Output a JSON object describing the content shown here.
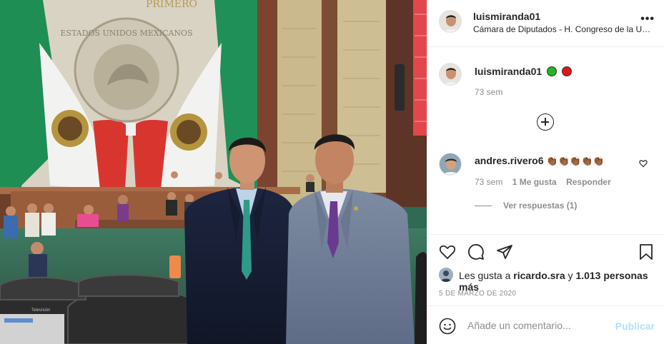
{
  "post": {
    "username": "luismiranda01",
    "location": "Cámara de Diputados - H. Congreso de la Unión",
    "more_icon": "more-horizontal-icon"
  },
  "photo": {
    "banner_text": "PRIMERO",
    "seal_text": "ESTADOS UNIDOS MEXICANOS",
    "brand_small": "Televisión"
  },
  "caption": {
    "username": "luismiranda01",
    "emoji_colors": [
      "#1fb820",
      "#e0161b"
    ],
    "age": "73 sem"
  },
  "load_more_icon": "plus-circle-icon",
  "comment": {
    "username": "andres.rivero6",
    "emoji": "👏🏾👏🏾👏🏾👏🏾👏🏾",
    "age": "73 sem",
    "likes": "1 Me gusta",
    "reply": "Responder",
    "view_replies": "Ver respuestas (1)",
    "like_icon": "heart-outline-icon"
  },
  "actions": {
    "like_icon": "heart-icon",
    "comment_icon": "comment-icon",
    "share_icon": "send-icon",
    "save_icon": "bookmark-icon"
  },
  "likes": {
    "prefix": "Les gusta a",
    "first_user": "ricardo.sra",
    "connector": "y",
    "others": "1.013 personas más"
  },
  "date": "5 DE MARZO DE 2020",
  "composer": {
    "emoji_icon": "smiley-icon",
    "placeholder": "Añade un comentario...",
    "publish": "Publicar"
  }
}
